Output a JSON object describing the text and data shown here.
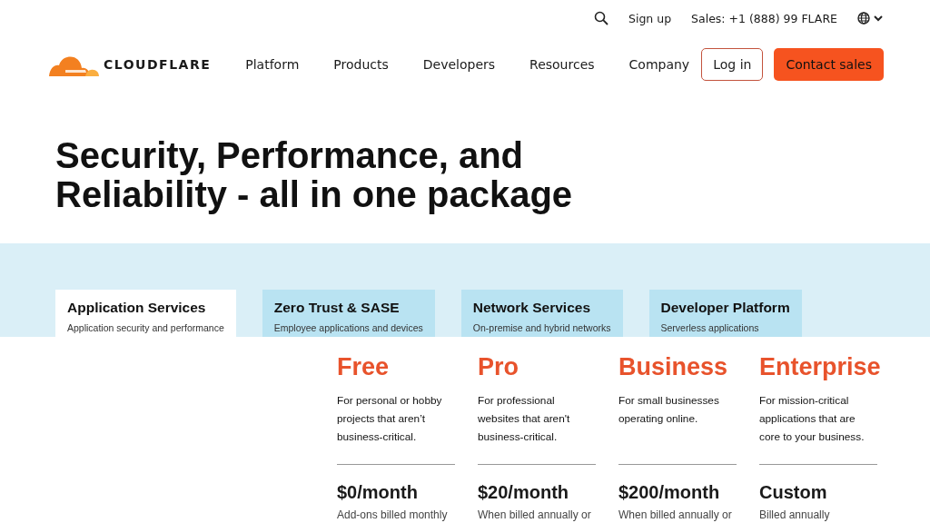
{
  "utility_bar": {
    "sign_up": "Sign up",
    "sales": "Sales: +1 (888) 99 FLARE"
  },
  "nav": {
    "logo": "CLOUDFLARE",
    "items": [
      "Platform",
      "Products",
      "Developers",
      "Resources",
      "Company"
    ],
    "login": "Log in",
    "contact": "Contact sales"
  },
  "headline": "Security, Performance, and Reliability - all in one package",
  "tabs": [
    {
      "title": "Application Services",
      "subtitle": "Application security and performance",
      "selected": true
    },
    {
      "title": "Zero Trust & SASE",
      "subtitle": "Employee applications and devices",
      "selected": false
    },
    {
      "title": "Network Services",
      "subtitle": "On-premise and hybrid networks",
      "selected": false
    },
    {
      "title": "Developer Platform",
      "subtitle": "Serverless applications",
      "selected": false
    }
  ],
  "plans": [
    {
      "name": "Free",
      "description": "For personal or hobby projects that aren’t business-critical.",
      "price": "$0/month",
      "note": "Add-ons billed monthly"
    },
    {
      "name": "Pro",
      "description": "For professional websites that aren't business-critical.",
      "price": "$20/month",
      "note": "When billed annually or"
    },
    {
      "name": "Business",
      "description": "For small businesses operating online.",
      "price": "$200/month",
      "note": "When billed annually or"
    },
    {
      "name": "Enterprise",
      "description": "For mission-critical applications that are core to your business.",
      "price": "Custom",
      "note": "Billed annually"
    }
  ]
}
